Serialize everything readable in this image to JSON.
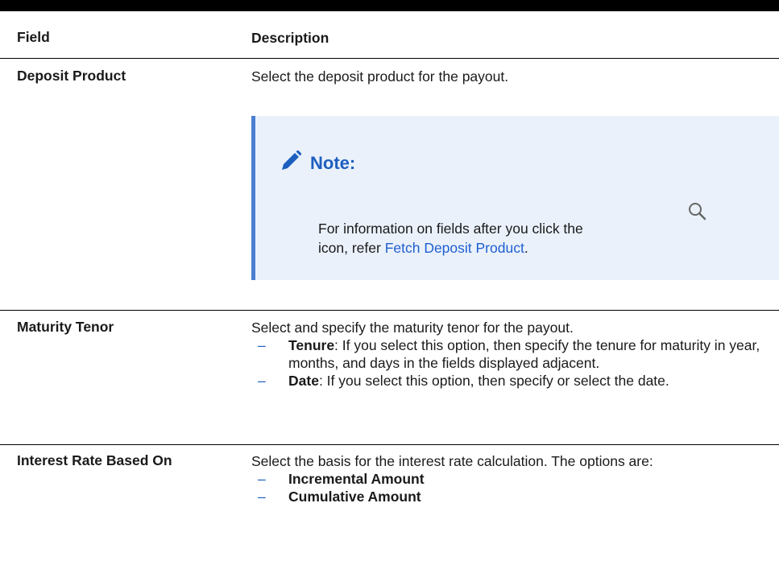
{
  "table": {
    "headers": {
      "field": "Field",
      "description": "Description"
    },
    "rows": [
      {
        "field": "Deposit Product",
        "description": "Select the deposit product for the payout.",
        "note": {
          "title": "Note:",
          "text_before": "For information on fields after you click the",
          "text_icon_line": "icon, refer",
          "link": "Fetch Deposit Product",
          "trailing": "."
        }
      },
      {
        "field": "Maturity Tenor",
        "description": "Select and specify the maturity tenor for the payout.",
        "items": [
          {
            "term": "Tenure",
            "text": ": If you select this option, then specify the tenure for maturity in year, months, and days in the fields displayed adjacent."
          },
          {
            "term": "Date",
            "text": ": If you select this option, then specify or select the date."
          }
        ]
      },
      {
        "field": "Interest Rate Based On",
        "description": "Select the basis for the interest rate calculation. The options are:",
        "items": [
          {
            "term": "Incremental Amount"
          },
          {
            "term": "Cumulative Amount"
          }
        ]
      }
    ]
  },
  "colors": {
    "note_background": "#eaf1fb",
    "note_accent": "#4a7fd1",
    "link": "#1f5fd0"
  },
  "icons": {
    "note": "pencil-icon",
    "lookup": "search-icon"
  }
}
